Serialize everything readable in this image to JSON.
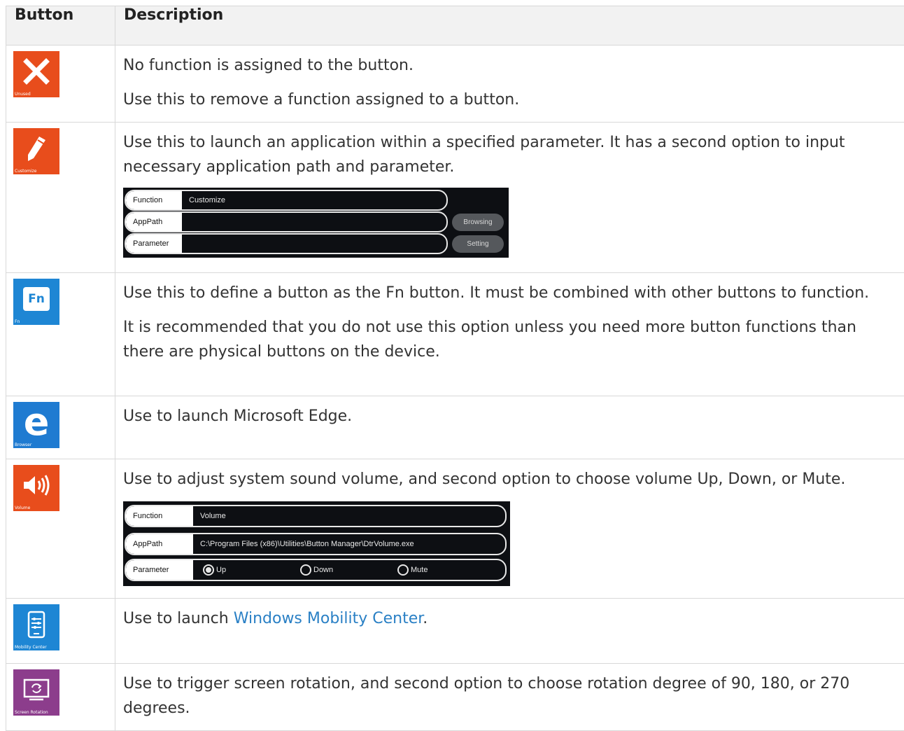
{
  "table": {
    "headers": {
      "button": "Button",
      "description": "Description"
    },
    "rows": [
      {
        "icon_caption": "Unused",
        "desc": [
          "No function is assigned to the button.",
          "Use this to remove a function assigned to a button."
        ]
      },
      {
        "icon_caption": "Customize",
        "desc": [
          "Use this to launch an application within a specified parameter. It has a second option to input necessary application path and parameter."
        ],
        "screenshot": {
          "function_label": "Function",
          "function_value": "Customize",
          "apppath_label": "AppPath",
          "apppath_value": "",
          "parameter_label": "Parameter",
          "parameter_value": "",
          "browse_button": "Browsing",
          "setting_button": "Setting"
        }
      },
      {
        "icon_caption": "Fn",
        "icon_text": "Fn",
        "desc": [
          "Use this to define a button as the Fn button. It must be combined with other buttons to function.",
          "It is recommended that you do not use this option unless you need more button functions than there are physical buttons on the device."
        ]
      },
      {
        "icon_caption": "Browser",
        "icon_text": "e",
        "desc": [
          "Use to launch Microsoft Edge."
        ]
      },
      {
        "icon_caption": "Volume",
        "desc": [
          "Use to adjust system sound volume, and second option to choose volume Up, Down, or Mute."
        ],
        "screenshot": {
          "function_label": "Function",
          "function_value": "Volume",
          "apppath_label": "AppPath",
          "apppath_value": "C:\\Program Files (x86)\\Utilities\\Button Manager\\DtrVolume.exe",
          "parameter_label": "Parameter",
          "options": [
            "Up",
            "Down",
            "Mute"
          ],
          "selected": "Up"
        }
      },
      {
        "icon_caption": "Mobility Center",
        "desc_prefix": "Use to launch ",
        "desc_link": "Windows Mobility Center",
        "desc_suffix": "."
      },
      {
        "icon_caption": "Screen Rotation",
        "desc": [
          "Use to trigger screen rotation, and second option to choose rotation degree of 90, 180, or 270 degrees."
        ]
      }
    ]
  },
  "colors": {
    "orange": "#e84d1c",
    "blue": "#1e86d4",
    "purple": "#8c3d8c",
    "link": "#2a80c5",
    "header_bg": "#f2f2f2"
  }
}
